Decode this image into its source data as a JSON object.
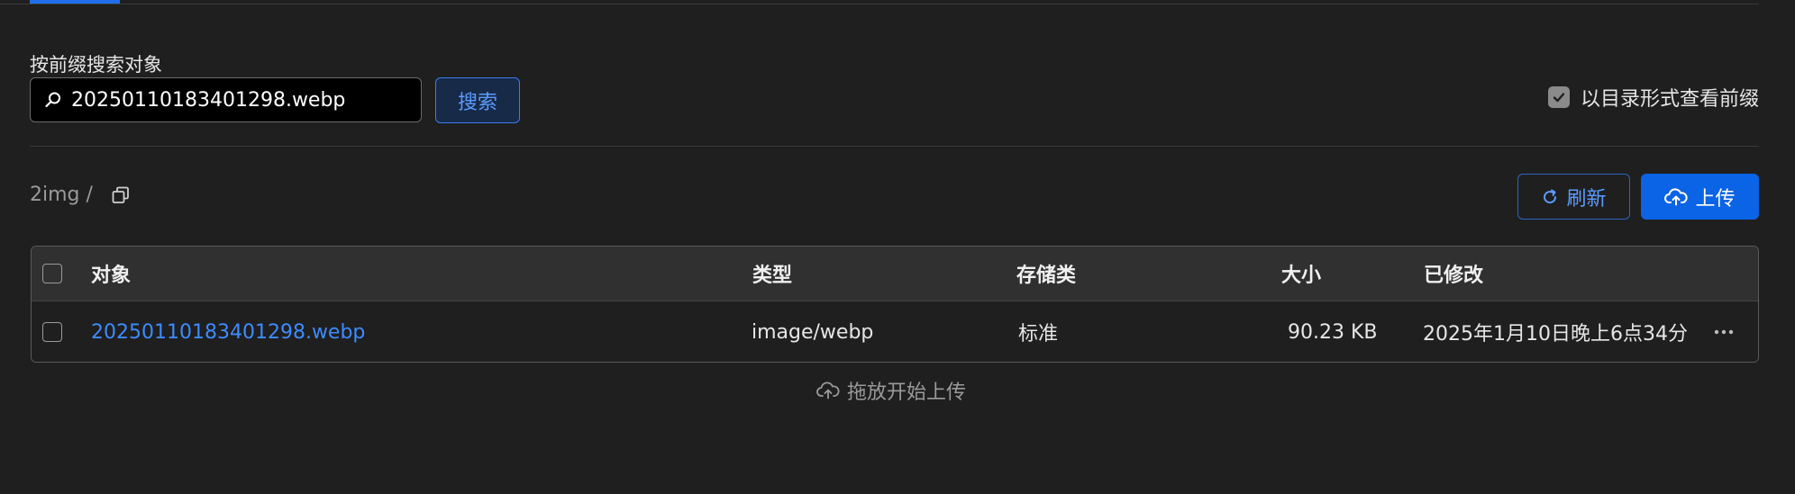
{
  "search": {
    "label": "按前缀搜索对象",
    "value": "20250110183401298.webp",
    "button_label": "搜索"
  },
  "view_toggle": {
    "label": "以目录形式查看前缀",
    "checked": true
  },
  "breadcrumb": {
    "path": "2img /"
  },
  "toolbar": {
    "refresh_label": "刷新",
    "upload_label": "上传"
  },
  "table": {
    "columns": [
      "对象",
      "类型",
      "存储类",
      "大小",
      "已修改"
    ],
    "rows": [
      {
        "name": "20250110183401298.webp",
        "type": "image/webp",
        "storage_class": "标准",
        "size": "90.23 KB",
        "modified": "2025年1月10日晚上6点34分"
      }
    ]
  },
  "drop_hint": "拖放开始上传",
  "colors": {
    "background": "#1f1f1f",
    "accent": "#0b63e5",
    "link": "#3d8bff"
  }
}
